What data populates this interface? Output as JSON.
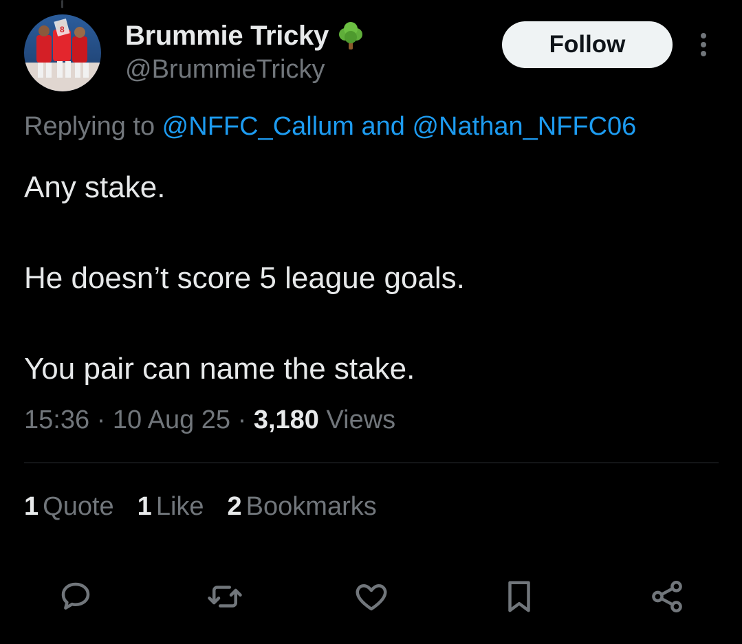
{
  "tweet": {
    "author": {
      "display_name": "Brummie Tricky",
      "handle": "@BrummieTricky",
      "badge_emoji": "deciduous-tree-icon"
    },
    "follow_label": "Follow",
    "replying": {
      "prefix": "Replying to ",
      "mention_1": "@NFFC_Callum",
      "conjunction": " and ",
      "mention_2": "@Nathan_NFFC06"
    },
    "text_lines": [
      "Any stake.",
      "He doesn’t score 5 league goals.",
      "You pair can name the stake."
    ],
    "meta": {
      "time": "15:36",
      "sep1": " · ",
      "date": "10 Aug 25",
      "sep2": " · ",
      "views_count": "3,180",
      "views_label": " Views"
    },
    "stats": {
      "quotes_count": "1",
      "quotes_label": "Quote",
      "likes_count": "1",
      "likes_label": "Like",
      "bookmarks_count": "2",
      "bookmarks_label": "Bookmarks"
    },
    "actions": [
      "reply-icon",
      "retweet-icon",
      "like-icon",
      "bookmark-icon",
      "share-icon"
    ]
  },
  "colors": {
    "background": "#000000",
    "text_primary": "#e7e9ea",
    "text_secondary": "#71767b",
    "link": "#1d9bf0",
    "divider": "#2f3336",
    "follow_bg": "#eff3f4"
  }
}
